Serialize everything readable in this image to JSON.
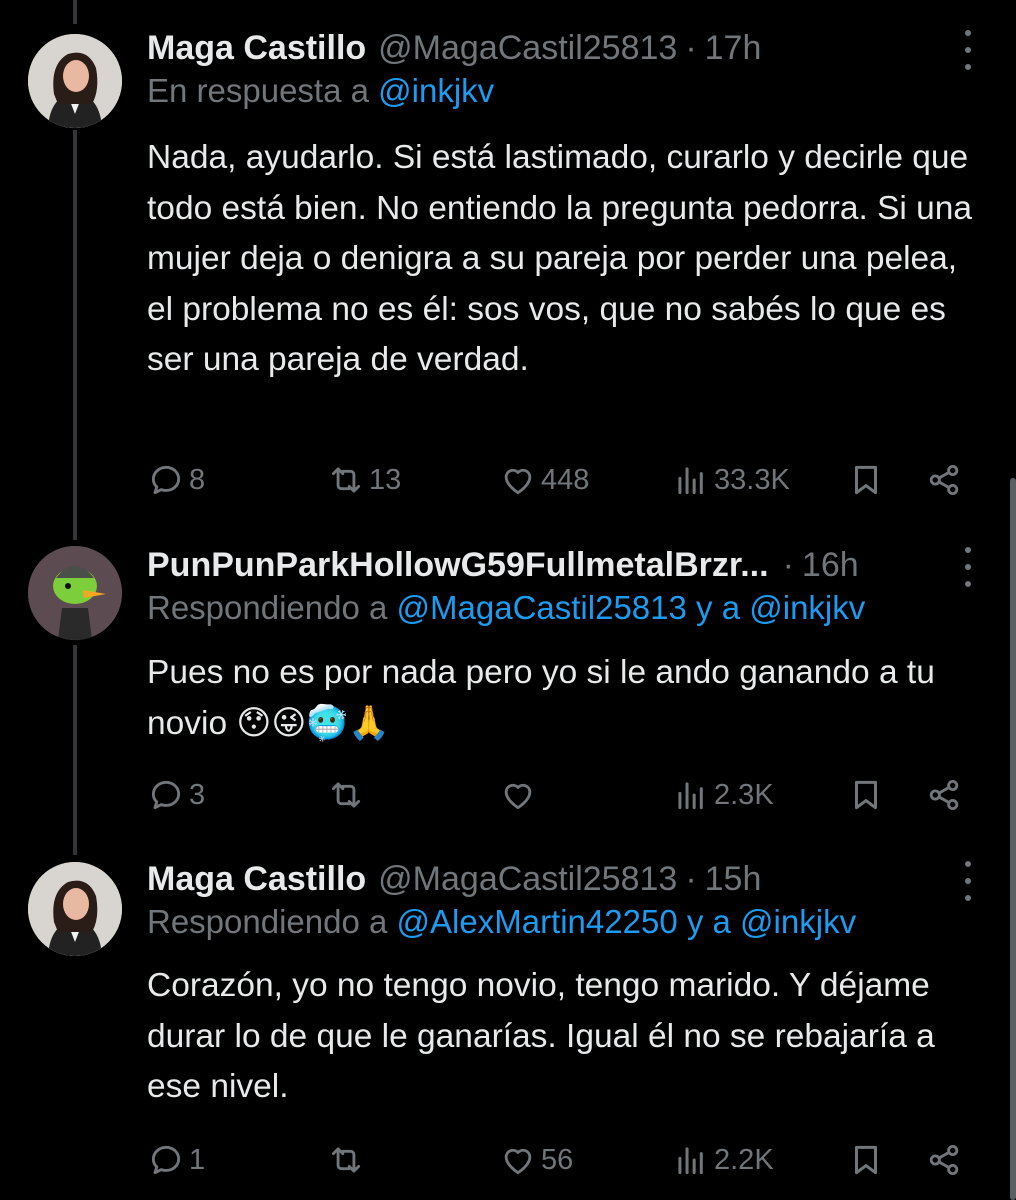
{
  "tweets": [
    {
      "name": "Maga Castillo",
      "handle": "@MagaCastil25813",
      "time": "17h",
      "reply_prefix": "En respuesta a ",
      "reply_mentions": "@inkjkv",
      "reply_suffix": "",
      "reply_mention2": "",
      "text": "Nada, ayudarlo. Si está lastimado, curarlo y decirle que todo está bien. No entiendo la pregunta pedorra. Si una mujer deja o denigra a su pareja por perder una pelea, el problema no es él: sos vos, que no sabés lo que es ser una pareja de verdad.",
      "replies": "8",
      "retweets": "13",
      "likes": "448",
      "views": "33.3K"
    },
    {
      "name": "PunPunParkHollowG59FullmetalBrzr...",
      "handle": "",
      "time": "16h",
      "reply_prefix": "Respondiendo a ",
      "reply_mentions": "@MagaCastil25813",
      "reply_suffix": " y a ",
      "reply_mention2": "@inkjkv",
      "text": "Pues no es por nada pero yo si le ando ganando a tu novio 😯😜🥶🙏",
      "replies": "3",
      "retweets": "",
      "likes": "",
      "views": "2.3K"
    },
    {
      "name": "Maga Castillo",
      "handle": "@MagaCastil25813",
      "time": "15h",
      "reply_prefix": "Respondiendo a ",
      "reply_mentions": "@AlexMartin42250",
      "reply_suffix": " y a ",
      "reply_mention2": "@inkjkv",
      "text": "Corazón, yo no tengo novio, tengo marido. Y déjame durar lo de que le ganarías. Igual él no se rebajaría a ese nivel.",
      "replies": "1",
      "retweets": "",
      "likes": "56",
      "views": "2.2K"
    }
  ],
  "icons": {
    "reply": "reply-icon",
    "retweet": "retweet-icon",
    "like": "heart-icon",
    "views": "views-icon",
    "bookmark": "bookmark-icon",
    "share": "share-icon",
    "more": "more-icon"
  },
  "colors": {
    "background": "#000000",
    "text": "#e7e9ea",
    "secondary": "#71767b",
    "link": "#1d9bf0"
  }
}
